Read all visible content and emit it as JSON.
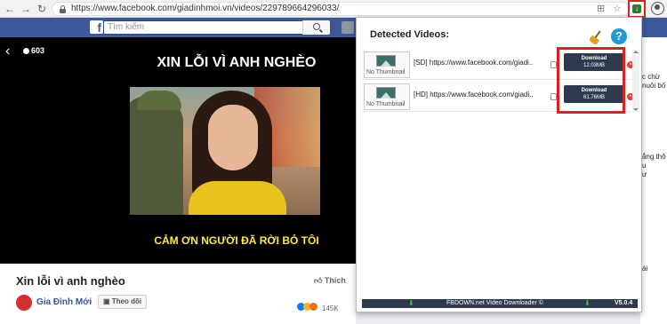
{
  "browser": {
    "url": "https://www.facebook.com/giadinhmoi.vn/videos/229789664296033/"
  },
  "facebook": {
    "search_placeholder": "Tìm kiếm"
  },
  "video": {
    "viewers": "603",
    "top_title": "XIN LỖI VÌ ANH NGHÈO",
    "bottom_title": "CẢM ƠN NGƯỜI ĐÃ RỜI BỎ TÔI"
  },
  "post": {
    "title": "Xin lỗi vì anh nghèo",
    "like_label": "Thích",
    "page_name": "Gia Đình Mới",
    "follow_label": "Theo dõi",
    "reaction_count": "145K"
  },
  "right_column": {
    "lines": [
      "c chừ",
      "nuôi bố",
      "ắng thô",
      "u",
      "ư",
      "ái"
    ]
  },
  "popup": {
    "title": "Detected Videos:",
    "videos": [
      {
        "thumb": "No Thumbnail",
        "text": "[SD] https://www.facebook.com/giadi...",
        "button": "Download",
        "size": "12.03MB"
      },
      {
        "thumb": "No Thumbnail",
        "text": "[HD] https://www.facebook.com/giadi...",
        "button": "Download",
        "size": "61.76MB"
      }
    ],
    "footer_text": "FBDOWN.net Video Downloader ©",
    "version": "V5.0.4"
  },
  "colors": {
    "facebook_blue": "#3b5998",
    "download_button": "#2e3b4e",
    "highlight": "#e02020",
    "help_blue": "#1e9bd8"
  }
}
